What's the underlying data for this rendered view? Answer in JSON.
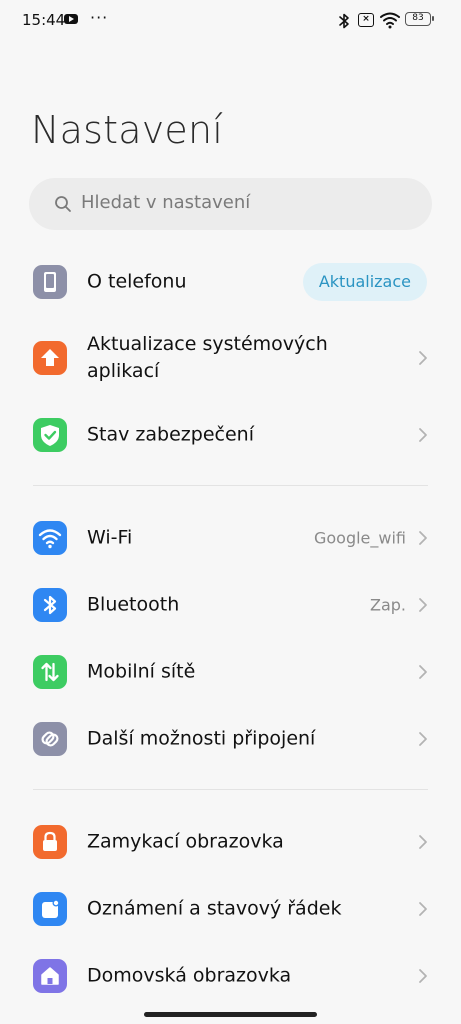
{
  "status_bar": {
    "time": "15:44",
    "battery": "83"
  },
  "header": {
    "title": "Nastavení"
  },
  "search": {
    "placeholder": "Hledat v nastavení"
  },
  "sections": [
    {
      "items": [
        {
          "label": "O telefonu",
          "badge": "Aktualizace",
          "icon": "phone-icon",
          "color": "#8d90a8"
        },
        {
          "label": "Aktualizace systémových aplikací",
          "icon": "arrow-up-icon",
          "color": "#f26a2e"
        },
        {
          "label": "Stav zabezpečení",
          "icon": "shield-check-icon",
          "color": "#3dcc62"
        }
      ]
    },
    {
      "items": [
        {
          "label": "Wi-Fi",
          "value": "Google_wifi",
          "icon": "wifi-icon",
          "color": "#2f87f2"
        },
        {
          "label": "Bluetooth",
          "value": "Zap.",
          "icon": "bluetooth-icon",
          "color": "#2f87f2"
        },
        {
          "label": "Mobilní sítě",
          "icon": "mobile-data-icon",
          "color": "#3dcc62"
        },
        {
          "label": "Další možnosti připojení",
          "icon": "link-icon",
          "color": "#8d90a8"
        }
      ]
    },
    {
      "items": [
        {
          "label": "Zamykací obrazovka",
          "icon": "lock-icon",
          "color": "#f26a2e"
        },
        {
          "label": "Oznámení a stavový řádek",
          "icon": "notification-icon",
          "color": "#2f87f2"
        },
        {
          "label": "Domovská obrazovka",
          "icon": "home-icon",
          "color": "#7f74e6"
        }
      ]
    }
  ]
}
